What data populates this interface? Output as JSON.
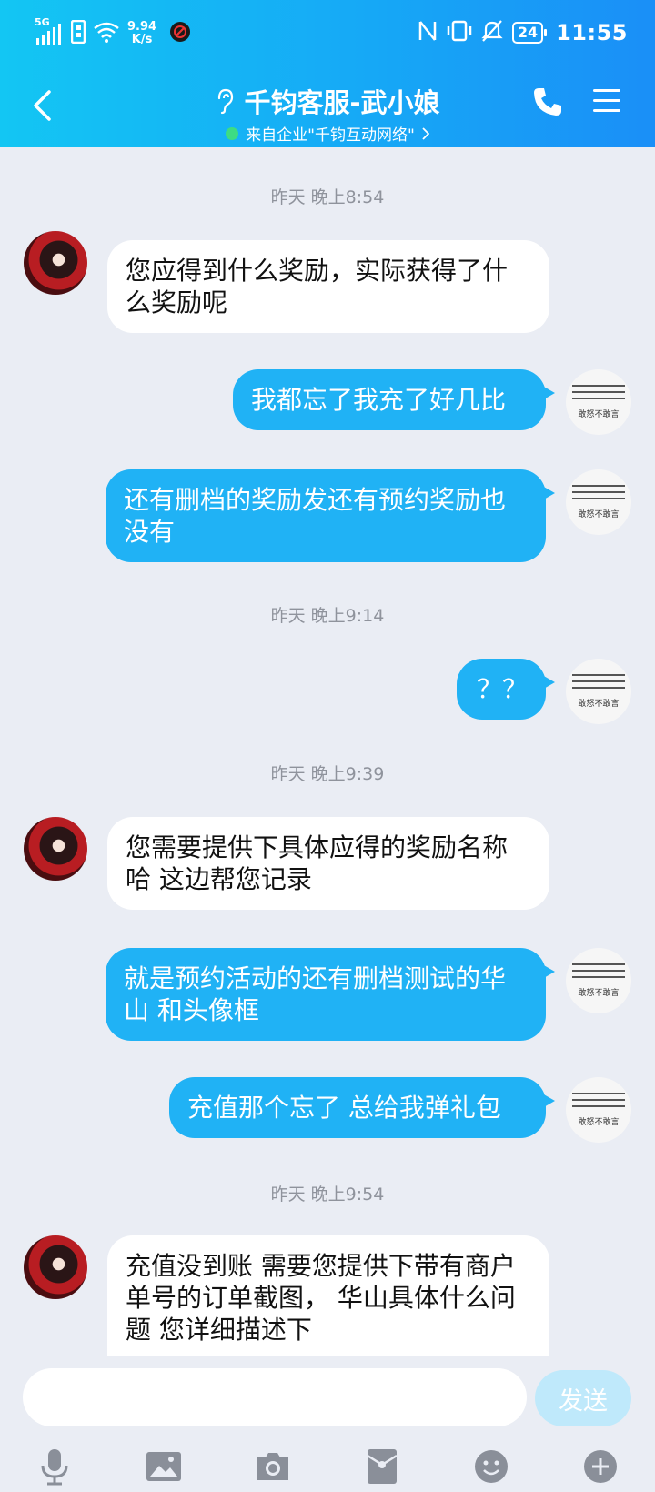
{
  "status_bar": {
    "network": "5G",
    "speed_value": "9.94",
    "speed_unit": "K/s",
    "battery": "24",
    "time": "11:55"
  },
  "header": {
    "title": "千钧客服-武小娘",
    "subtitle": "来自企业\"千钧互动网络\"",
    "user_avatar_text": "敢怒不敢言"
  },
  "messages": [
    {
      "type": "time",
      "text": "昨天 晚上8:54"
    },
    {
      "type": "in",
      "text": "您应得到什么奖励，实际获得了什么奖励呢"
    },
    {
      "type": "out",
      "text": "我都忘了我充了好几比"
    },
    {
      "type": "out",
      "text": "还有删档的奖励发还有预约奖励也没有"
    },
    {
      "type": "time",
      "text": "昨天 晚上9:14"
    },
    {
      "type": "out",
      "text": "？？"
    },
    {
      "type": "time",
      "text": "昨天 晚上9:39"
    },
    {
      "type": "in",
      "text": "您需要提供下具体应得的奖励名称哈  这边帮您记录"
    },
    {
      "type": "out",
      "text": "就是预约活动的还有删档测试的华山 和头像框"
    },
    {
      "type": "out",
      "text": "充值那个忘了 总给我弹礼包"
    },
    {
      "type": "time",
      "text": "昨天 晚上9:54"
    },
    {
      "type": "in",
      "text": "充值没到账 需要您提供下带有商户单号的订单截图， 华山具体什么问题 您详细描述下"
    }
  ],
  "input": {
    "value": "",
    "send_label": "发送"
  },
  "colors": {
    "header_start": "#13c6f3",
    "header_end": "#1a8ff7",
    "outgoing_bubble": "#20b2f5",
    "incoming_bubble": "#ffffff",
    "background": "#eaedf4",
    "send_disabled": "#bfe9fb"
  },
  "toolbar_icons": [
    "microphone-icon",
    "image-icon",
    "camera-icon",
    "red-packet-icon",
    "emoji-icon",
    "plus-icon"
  ]
}
